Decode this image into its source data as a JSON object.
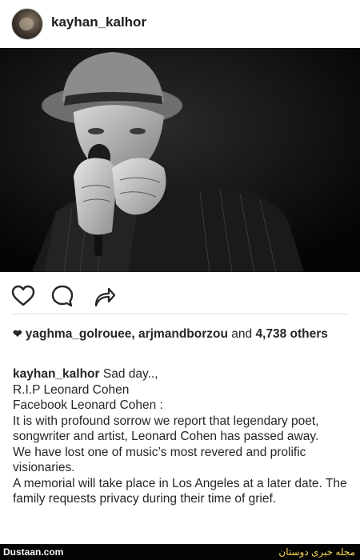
{
  "post": {
    "username": "kayhan_kalhor",
    "likes": {
      "names": "yaghma_golrouee, arjmandborzou",
      "connector": " and ",
      "count": "4,738",
      "suffix": " others"
    },
    "caption": {
      "username": "kayhan_kalhor",
      "lines": [
        "Sad day..,",
        "R.I.P Leonard Cohen",
        "Facebook Leonard Cohen :",
        "It is with profound sorrow we report that legendary poet, songwriter and artist, Leonard Cohen has passed away.",
        "We have lost one of music’s most revered and prolific visionaries.",
        "A memorial will take place in Los Angeles at a later date. The family requests privacy during their time of grief."
      ]
    }
  },
  "icons": {
    "like": "heart-outline-icon",
    "comment": "speech-bubble-icon",
    "share": "share-arrow-icon",
    "likes_prefix": "heart-filled-icon"
  },
  "footer": {
    "site": "Dustaan.com",
    "tagline": "مجله خبری دوستان"
  },
  "colors": {
    "text": "#262626",
    "photo_bg": "#0b0b0b",
    "footer_bg": "#050505",
    "footer_accent": "#f7d84f"
  }
}
